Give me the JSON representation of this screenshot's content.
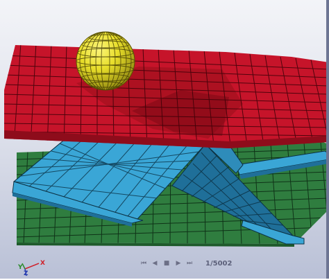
{
  "viewer": {
    "background_top": "#f3f4f8",
    "background_bottom": "#b9c0d6"
  },
  "scene": {
    "ball": {
      "color": "#e8de2a",
      "shade": "#8d8510",
      "mesh": "#3a3300"
    },
    "upper_plate": {
      "color": "#c6142a",
      "shade": "#8e0c1b",
      "mesh": "#3a0008"
    },
    "stiffener": {
      "color": "#3aa6d6",
      "shade": "#1f6f99",
      "mesh": "#0c3144"
    },
    "base_plate": {
      "color": "#2f7d3f",
      "shade": "#1e5a2b",
      "mesh": "#0d2b14"
    }
  },
  "playback": {
    "buttons": [
      {
        "name": "first-frame-button",
        "glyph": "⏮"
      },
      {
        "name": "previous-frame-button",
        "glyph": "◀"
      },
      {
        "name": "stop-button",
        "glyph": "■"
      },
      {
        "name": "next-frame-button",
        "glyph": "▶"
      },
      {
        "name": "last-frame-button",
        "glyph": "⏭"
      }
    ],
    "frame_counter": "1/5002"
  },
  "axis_triad": {
    "x_label": "X",
    "y_label": "Y",
    "z_label": "Z"
  }
}
